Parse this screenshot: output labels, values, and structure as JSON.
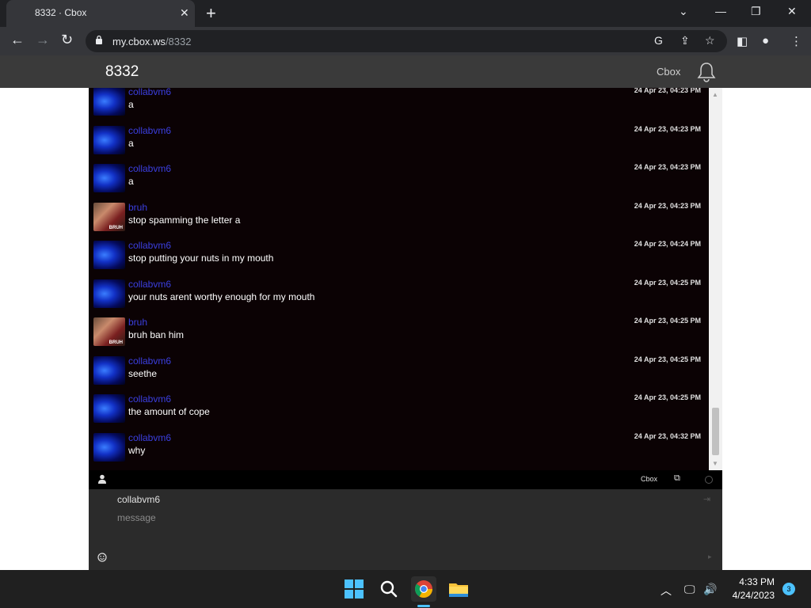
{
  "browser": {
    "tab_title": "8332 · Cbox",
    "url_host": "my.cbox.ws",
    "url_path": "/8332"
  },
  "cbox": {
    "title": "8332",
    "brand": "Cbox"
  },
  "messages": [
    {
      "user": "collabvm6",
      "text": "a",
      "time": "24 Apr 23, 04:23 PM",
      "avatar": "blue"
    },
    {
      "user": "collabvm6",
      "text": "a",
      "time": "24 Apr 23, 04:23 PM",
      "avatar": "blue"
    },
    {
      "user": "collabvm6",
      "text": "a",
      "time": "24 Apr 23, 04:23 PM",
      "avatar": "blue"
    },
    {
      "user": "bruh",
      "text": "stop spamming the letter a",
      "time": "24 Apr 23, 04:23 PM",
      "avatar": "bruh"
    },
    {
      "user": "collabvm6",
      "text": "stop putting your nuts in my mouth",
      "time": "24 Apr 23, 04:24 PM",
      "avatar": "blue"
    },
    {
      "user": "collabvm6",
      "text": "your nuts arent worthy enough for my mouth",
      "time": "24 Apr 23, 04:25 PM",
      "avatar": "blue"
    },
    {
      "user": "bruh",
      "text": "bruh ban him",
      "time": "24 Apr 23, 04:25 PM",
      "avatar": "bruh"
    },
    {
      "user": "collabvm6",
      "text": "seethe",
      "time": "24 Apr 23, 04:25 PM",
      "avatar": "blue"
    },
    {
      "user": "collabvm6",
      "text": "the amount of cope",
      "time": "24 Apr 23, 04:25 PM",
      "avatar": "blue"
    },
    {
      "user": "collabvm6",
      "text": "why",
      "time": "24 Apr 23, 04:32 PM",
      "avatar": "blue"
    }
  ],
  "avatar_tag": "BRUH",
  "statusbar": {
    "brand": "Cbox"
  },
  "composer": {
    "name": "collabvm6",
    "message_placeholder": "message"
  },
  "taskbar": {
    "time": "4:33 PM",
    "date": "4/24/2023",
    "notifications": "3"
  },
  "colors": {
    "username": "#3b3fe0",
    "chat_bg": "#0b0204",
    "header_bg": "#3a3a3a"
  }
}
